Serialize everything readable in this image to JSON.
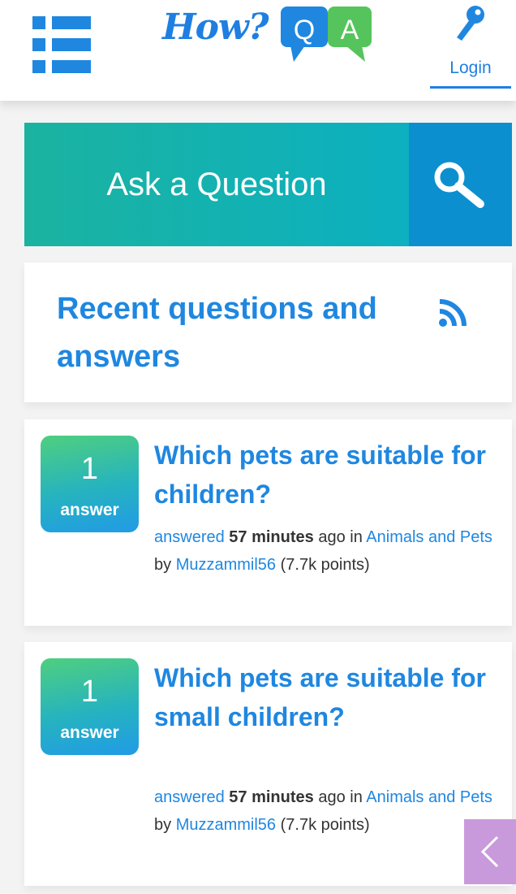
{
  "header": {
    "logo": {
      "text": "How?",
      "q_letter": "Q",
      "a_letter": "A"
    },
    "login_label": "Login"
  },
  "ask": {
    "label": "Ask a Question"
  },
  "section": {
    "title": "Recent questions and answers"
  },
  "questions": [
    {
      "answer_count": "1",
      "answer_label": "answer",
      "title": "Which pets are suitable for children?",
      "action": "answered",
      "time": "57 minutes",
      "time_suffix": "ago in",
      "category": "Animals and Pets",
      "by": "by",
      "user": "Muzzammil56",
      "points": "(7.7k points)"
    },
    {
      "answer_count": "1",
      "answer_label": "answer",
      "title": "Which pets are suitable for small children?",
      "action": "answered",
      "time": "57 minutes",
      "time_suffix": "ago in",
      "category": "Animals and Pets",
      "by": "by",
      "user": "Muzzammil56",
      "points": "(7.7k points)"
    }
  ],
  "colors": {
    "accent_blue": "#1f87e0",
    "ask_teal": "#1bb3a0",
    "search_blue": "#0c8fcf",
    "side_tab": "#c99adb"
  },
  "icons": {
    "menu": "menu-icon",
    "key": "key-icon",
    "search": "search-icon",
    "rss": "rss-icon",
    "chevron": "chevron-left-icon"
  }
}
